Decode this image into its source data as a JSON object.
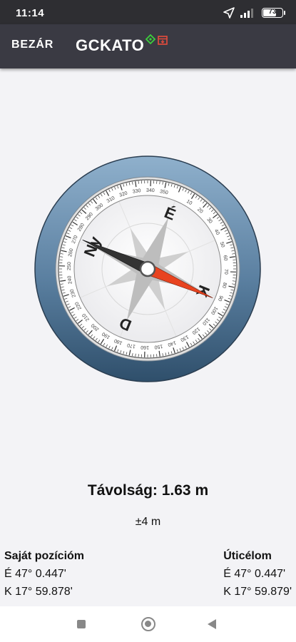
{
  "status_bar": {
    "time": "11:14",
    "battery_level": 73,
    "battery_text": "73"
  },
  "app_bar": {
    "close_label": "BEZÁR",
    "title": "GCKATO"
  },
  "compass": {
    "cardinals": {
      "north": "É",
      "east": "K",
      "south": "D",
      "west": "Ny"
    },
    "degree_labels": [
      "10",
      "20",
      "30",
      "40",
      "50",
      "60",
      "70",
      "80",
      "90",
      "100",
      "110",
      "120",
      "130",
      "140",
      "150",
      "160",
      "170",
      "180",
      "190",
      "200",
      "210",
      "220",
      "230",
      "240",
      "250",
      "260",
      "270",
      "280",
      "290",
      "300",
      "310",
      "320",
      "330",
      "340",
      "350"
    ],
    "dial_rotation_deg": 22,
    "pointer_target_deg": 114,
    "colors": {
      "bezel": "#5a7fa0",
      "target_needle": "#e8431f",
      "north_needle": "#333333",
      "rose": "#b8b8b8"
    }
  },
  "distance_text": "Távolság: 1.63 m",
  "accuracy_text": "±4 m",
  "own_position": {
    "title": "Saját pozícióm",
    "lat": "É 47° 0.447'",
    "lon": "K 17° 59.878'"
  },
  "destination": {
    "title": "Úticélom",
    "lat": "É 47° 0.447'",
    "lon": "K 17° 59.879'"
  },
  "icons": [
    "location-arrow-icon",
    "signal-icon",
    "battery-icon",
    "waypoint-icon",
    "cache-box-icon",
    "nav-recents-icon",
    "nav-home-icon",
    "nav-back-icon"
  ]
}
